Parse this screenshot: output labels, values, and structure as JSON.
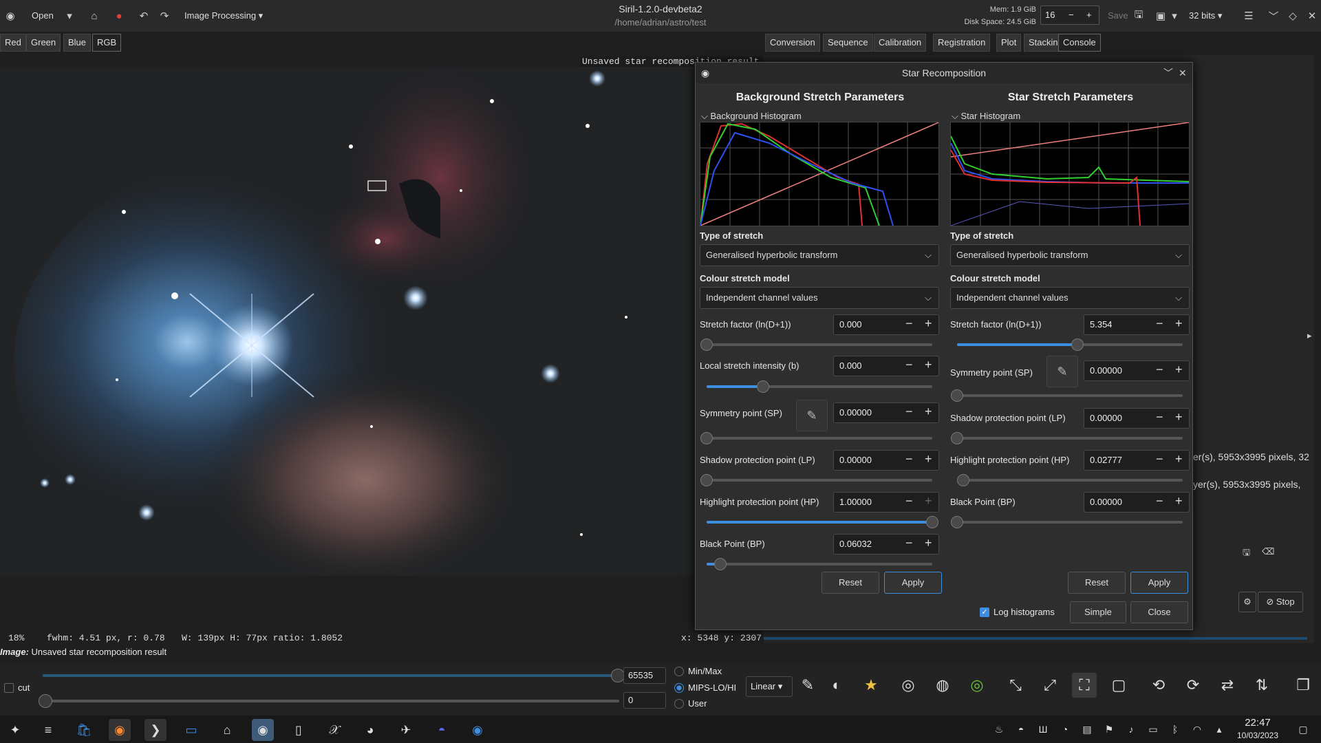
{
  "header": {
    "open_label": "Open",
    "processing_menu": "Image Processing",
    "title": "Siril-1.2.0-devbeta2",
    "path": "/home/adrian/astro/test",
    "mem": "Mem: 1.9 GiB",
    "disk": "Disk Space: 24.5 GiB",
    "threads": "16",
    "save": "Save",
    "bits": "32 bits"
  },
  "channels": [
    "Red",
    "Green",
    "Blue",
    "RGB"
  ],
  "tabs": [
    "Conversion",
    "Sequence",
    "Calibration",
    "Registration",
    "Plot",
    "Stacking",
    "Console"
  ],
  "image": {
    "overlay_text": "Unsaved star recomposition result"
  },
  "console": {
    "line1": "er(s), 5953x3995 pixels, 32",
    "line2": "yer(s), 5953x3995 pixels,",
    "stop": "Stop"
  },
  "status": {
    "zoom": "18%",
    "fwhm": "fwhm: 4.51 px, r: 0.78",
    "dims": "W: 139px H: 77px ratio: 1.8052",
    "coords": "x: 5348 y: 2307",
    "image_label": "Image:",
    "image_name": "Unsaved star recomposition result"
  },
  "bottom": {
    "cut_label": "cut",
    "high_value": "65535",
    "low_value": "0",
    "minmax": "Min/Max",
    "mips": "MIPS-LO/HI",
    "user": "User",
    "mode": "Linear"
  },
  "dialog": {
    "title": "Star Recomposition",
    "bg": {
      "heading": "Background Stretch Parameters",
      "histogram": "Background Histogram",
      "type_label": "Type of stretch",
      "type_value": "Generalised hyperbolic transform",
      "colour_label": "Colour stretch model",
      "colour_value": "Independent channel values",
      "stretch_label": "Stretch factor (ln(D+1))",
      "stretch_value": "0.000",
      "stretch_level": 0,
      "local_label": "Local stretch intensity (b)",
      "local_value": "0.000",
      "local_level": 0.25,
      "sp_label": "Symmetry point (SP)",
      "sp_value": "0.00000",
      "sp_level": 0,
      "lp_label": "Shadow protection point (LP)",
      "lp_value": "0.00000",
      "lp_level": 0,
      "hp_label": "Highlight protection point (HP)",
      "hp_value": "1.00000",
      "hp_level": 1,
      "bp_label": "Black Point (BP)",
      "bp_value": "0.06032",
      "bp_level": 0.06,
      "reset": "Reset",
      "apply": "Apply"
    },
    "star": {
      "heading": "Star Stretch Parameters",
      "histogram": "Star Histogram",
      "type_label": "Type of stretch",
      "type_value": "Generalised hyperbolic transform",
      "colour_label": "Colour stretch model",
      "colour_value": "Independent channel values",
      "stretch_label": "Stretch factor (ln(D+1))",
      "stretch_value": "5.354",
      "stretch_level": 0.535,
      "sp_label": "Symmetry point (SP)",
      "sp_value": "0.00000",
      "sp_level": 0,
      "lp_label": "Shadow protection point (LP)",
      "lp_value": "0.00000",
      "lp_level": 0,
      "hp_label": "Highlight protection point (HP)",
      "hp_value": "0.02777",
      "hp_level": 0.028,
      "bp_label": "Black Point (BP)",
      "bp_value": "0.00000",
      "bp_level": 0,
      "reset": "Reset",
      "apply": "Apply"
    },
    "log_histograms": "Log histograms",
    "simple": "Simple",
    "close": "Close"
  },
  "taskbar": {
    "time": "22:47",
    "date": "10/03/2023"
  },
  "colors": {
    "accent": "#3d8ee0",
    "background": "#1f1f1f"
  }
}
